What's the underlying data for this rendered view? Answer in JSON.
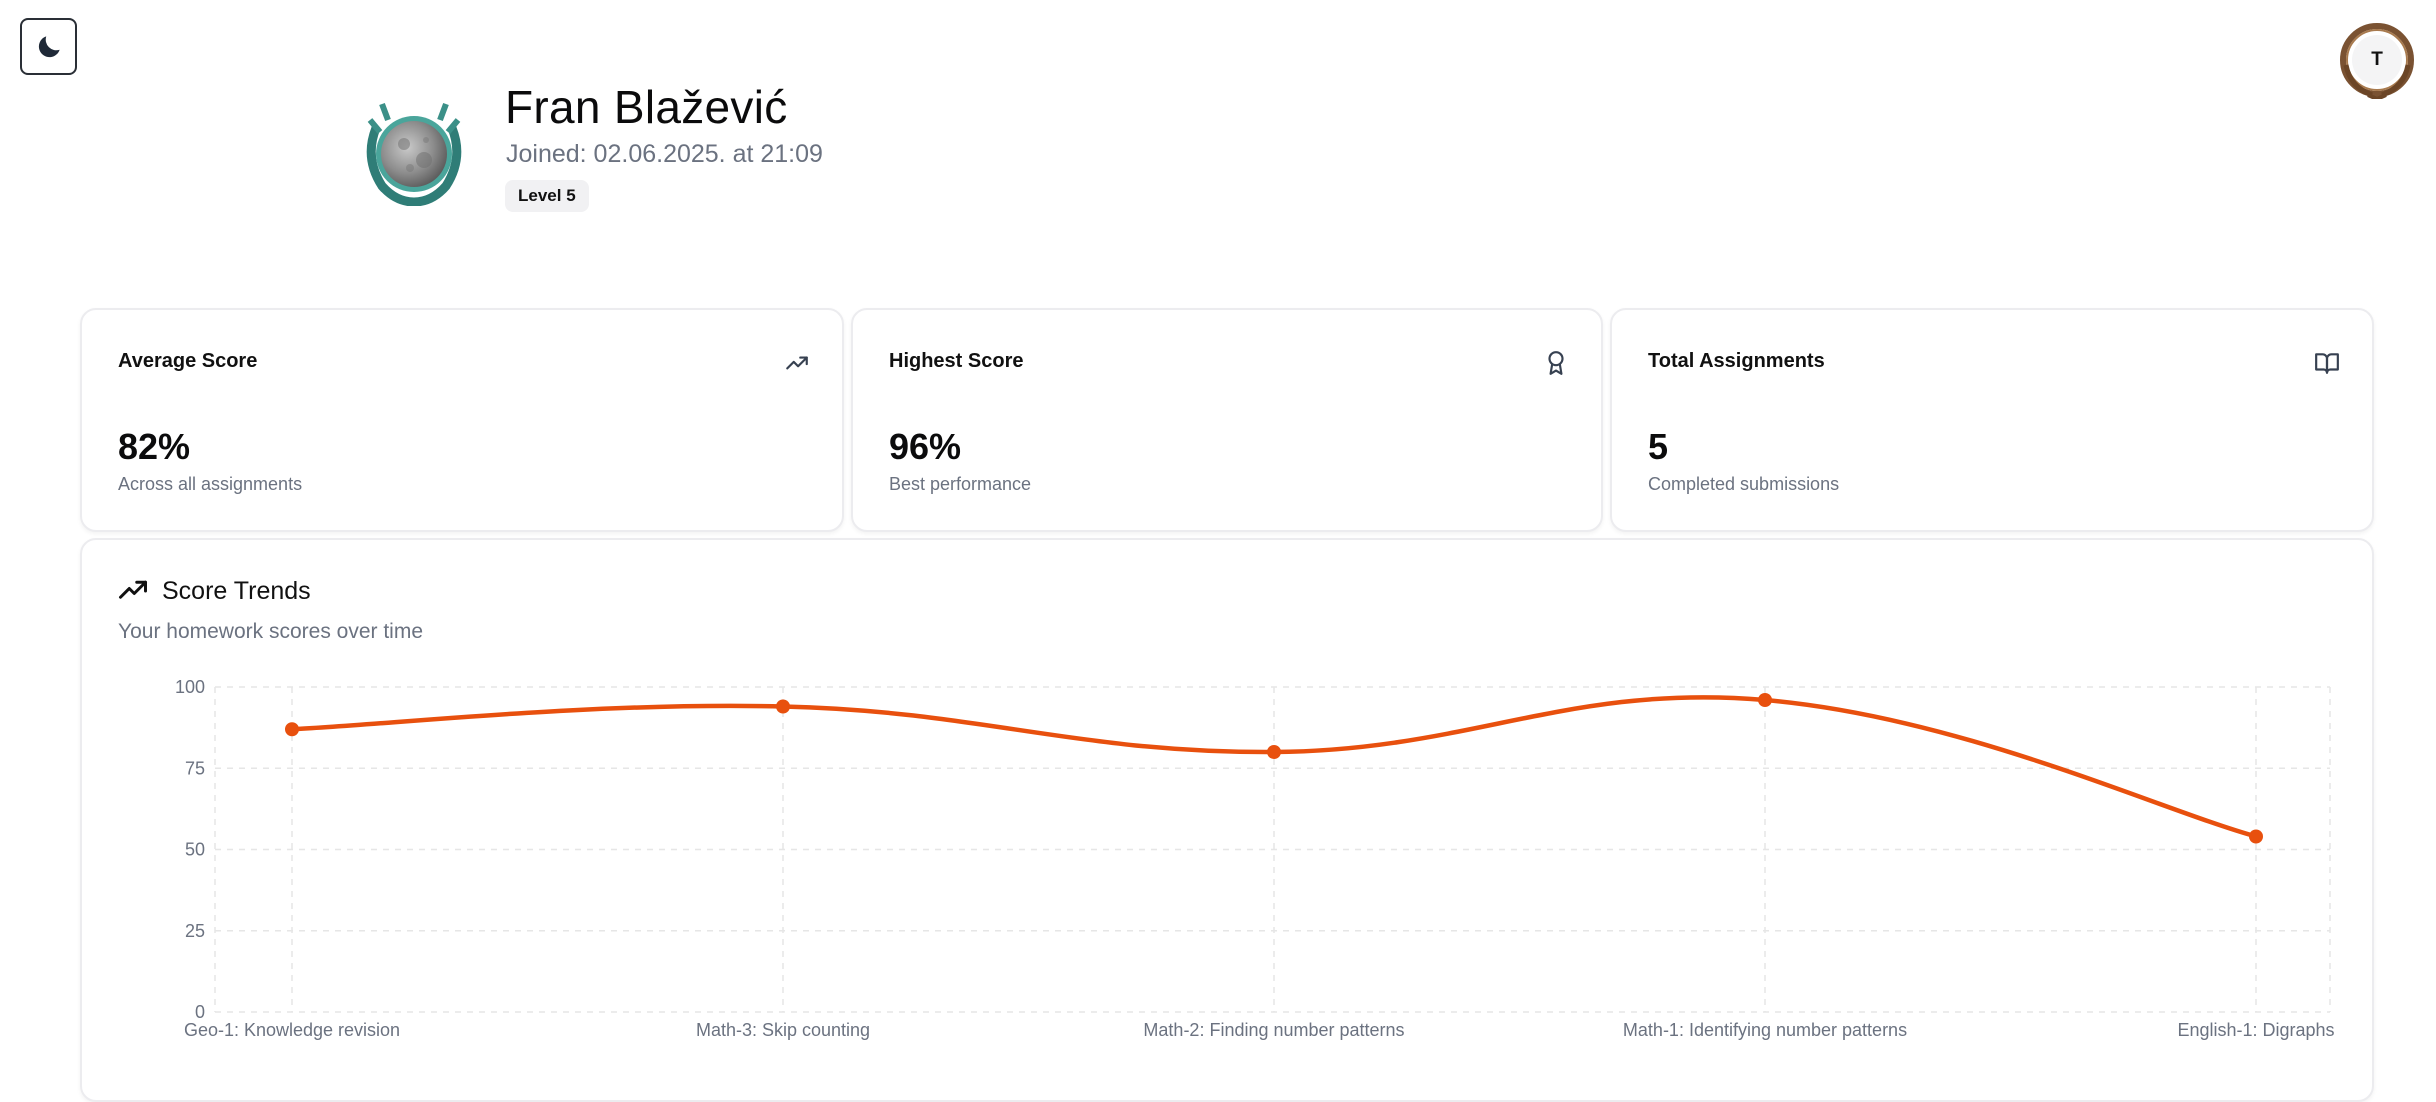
{
  "header": {
    "theme_toggle_icon": "moon-icon",
    "user_avatar_initial": "T"
  },
  "profile": {
    "name": "Fran Blažević",
    "joined": "Joined: 02.06.2025. at 21:09",
    "level": "Level 5",
    "emblem_icon": "moon-laurel-emblem-icon"
  },
  "stats": [
    {
      "title": "Average Score",
      "value": "82%",
      "sub": "Across all assignments",
      "icon": "trending-up-icon"
    },
    {
      "title": "Highest Score",
      "value": "96%",
      "sub": "Best performance",
      "icon": "award-icon"
    },
    {
      "title": "Total Assignments",
      "value": "5",
      "sub": "Completed submissions",
      "icon": "book-open-icon"
    }
  ],
  "chart": {
    "title": "Score Trends",
    "description": "Your homework scores over time",
    "title_icon": "trending-up-icon"
  },
  "colors": {
    "series_line": "#e8500e",
    "grid": "#e6e6e6",
    "axis_text": "#6b7280"
  },
  "chart_data": {
    "type": "line",
    "title": "Score Trends",
    "subtitle": "Your homework scores over time",
    "categories": [
      "Geo-1: Knowledge revision",
      "Math-3: Skip counting",
      "Math-2: Finding number patterns",
      "Math-1: Identifying number patterns",
      "English-1: Digraphs"
    ],
    "series": [
      {
        "values": [
          87,
          94,
          80,
          96,
          54
        ]
      }
    ],
    "yticks": [
      0,
      25,
      50,
      75,
      100
    ],
    "ylim": [
      0,
      100
    ],
    "grid": true,
    "curve": "smooth"
  }
}
